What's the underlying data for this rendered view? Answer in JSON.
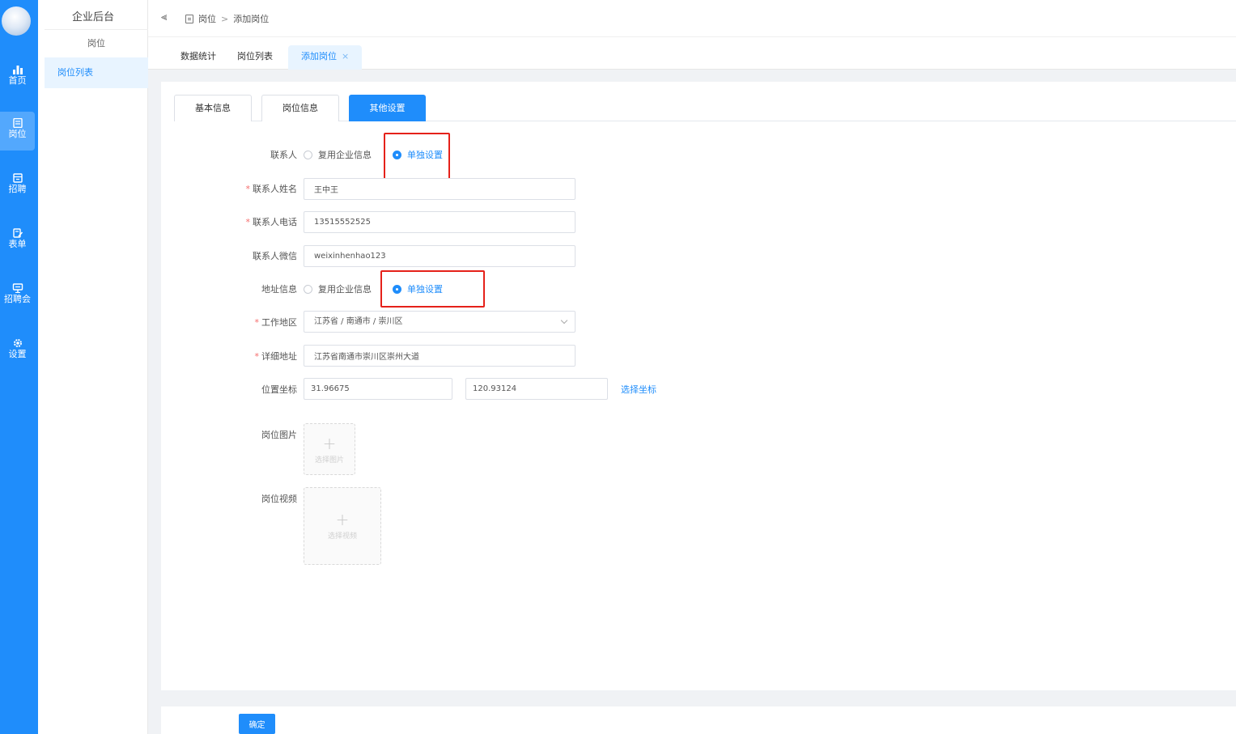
{
  "rail": {
    "items": [
      {
        "label": "首页",
        "icon": "bar-chart-icon"
      },
      {
        "label": "岗位",
        "icon": "document-icon"
      },
      {
        "label": "招聘",
        "icon": "calendar-icon"
      },
      {
        "label": "表单",
        "icon": "edit-form-icon"
      },
      {
        "label": "招聘会",
        "icon": "presentation-icon"
      },
      {
        "label": "设置",
        "icon": "gear-icon"
      }
    ],
    "active_index": 1,
    "color": "#1f8dfb"
  },
  "sidebar": {
    "title": "企业后台",
    "section": "岗位",
    "menu_item": "岗位列表"
  },
  "header": {
    "fold_icon": "menu-fold-icon",
    "breadcrumb": {
      "item1": "岗位",
      "separator": ">",
      "item2": "添加岗位"
    }
  },
  "page_tabs": [
    {
      "label": "数据统计"
    },
    {
      "label": "岗位列表"
    },
    {
      "label": "添加岗位",
      "closable": "×",
      "active": true
    }
  ],
  "form_tabs": [
    {
      "label": "基本信息"
    },
    {
      "label": "岗位信息"
    },
    {
      "label": "其他设置",
      "active": true
    }
  ],
  "form": {
    "contact": {
      "label": "联系人",
      "option_reuse": "复用企业信息",
      "option_custom": "单独设置",
      "selected": "单独设置"
    },
    "contact_name": {
      "label": "联系人姓名",
      "required": "*",
      "value": "王中王"
    },
    "contact_phone": {
      "label": "联系人电话",
      "required": "*",
      "value": "13515552525"
    },
    "contact_wechat": {
      "label": "联系人微信",
      "value": "weixinhenhao123"
    },
    "address": {
      "label": "地址信息",
      "option_reuse": "复用企业信息",
      "option_custom": "单独设置",
      "selected": "单独设置"
    },
    "work_region": {
      "label": "工作地区",
      "required": "*",
      "value": "江苏省 / 南通市 / 崇川区"
    },
    "detail_address": {
      "label": "详细地址",
      "required": "*",
      "value": "江苏省南通市崇川区崇州大道"
    },
    "coordinates": {
      "label": "位置坐标",
      "lat": "31.96675",
      "lng": "120.93124",
      "pick_link": "选择坐标"
    },
    "image": {
      "label": "岗位图片",
      "upload_text": "选择图片",
      "icon": "plus-icon"
    },
    "video": {
      "label": "岗位视频",
      "upload_text": "选择视频",
      "icon": "plus-icon"
    }
  },
  "footer": {
    "confirm": "确定"
  },
  "colors": {
    "primary": "#1f8dfb",
    "highlight_box": "#e5211a",
    "required": "#f56c6c"
  }
}
